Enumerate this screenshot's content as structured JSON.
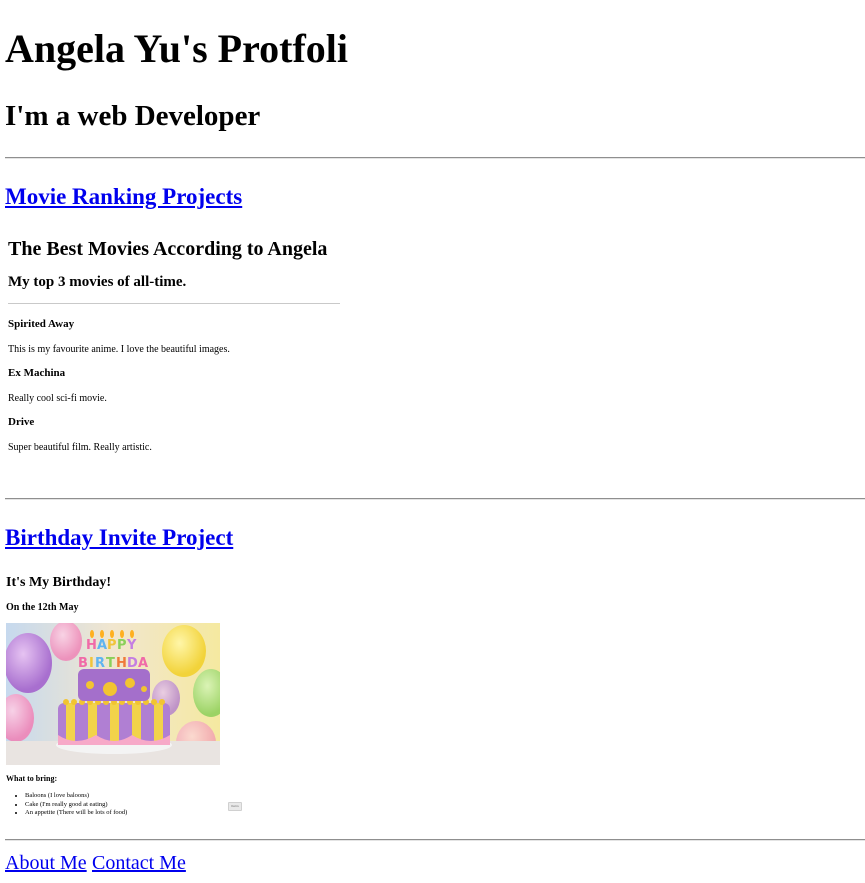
{
  "header": {
    "title": "Angela Yu's Protfoli",
    "subtitle": "I'm a web Developer"
  },
  "projects": [
    {
      "link_label": "Movie Ranking Projects"
    },
    {
      "link_label": "Birthday Invite Project"
    }
  ],
  "movie_page": {
    "title": "The Best Movies According to Angela",
    "subtitle": "My top 3 movies of all-time.",
    "movies": [
      {
        "name": "Spirited Away",
        "description": "This is my favourite anime. I love the beautiful images."
      },
      {
        "name": "Ex Machina",
        "description": "Really cool sci-fi movie."
      },
      {
        "name": "Drive",
        "description": "Super beautiful film. Really artistic."
      }
    ]
  },
  "birthday_page": {
    "title": "It's My Birthday!",
    "date": "On the 12th May",
    "cake_image_icon": "birthday-cake-image",
    "cake_text": "HAPPY BIRTHDAY",
    "bring_label": "What to bring:",
    "items": [
      "Baloons (I love baloons)",
      "Cake (I'm really good at eating)",
      "An appetite (There will be lots of food)"
    ],
    "button_label": "Form"
  },
  "footer": {
    "about_label": "About Me",
    "contact_label": "Contact Me"
  }
}
